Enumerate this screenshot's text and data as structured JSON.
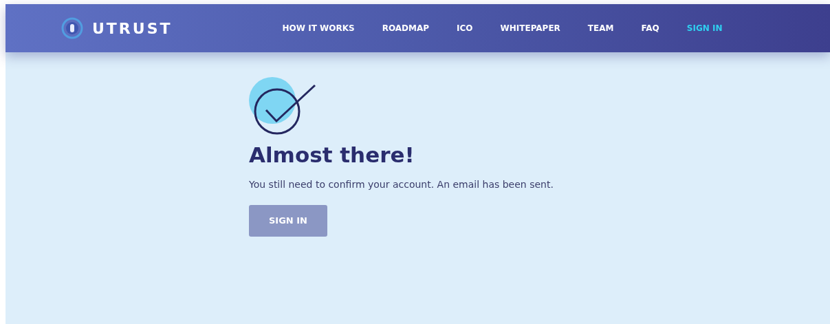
{
  "header": {
    "logo": "UTRUST",
    "nav": [
      {
        "label": "HOW IT WORKS",
        "selected": false
      },
      {
        "label": "ROADMAP",
        "selected": false
      },
      {
        "label": "ICO",
        "selected": false
      },
      {
        "label": "WHITEPAPER",
        "selected": false
      },
      {
        "label": "TEAM",
        "selected": false
      },
      {
        "label": "FAQ",
        "selected": false
      },
      {
        "label": "SIGN IN",
        "selected": true
      }
    ]
  },
  "message": {
    "title": "Almost there!",
    "text": "You still need to confirm your account. An email has been sent.",
    "button": {
      "label": "SIGN IN",
      "disabled": true
    }
  }
}
